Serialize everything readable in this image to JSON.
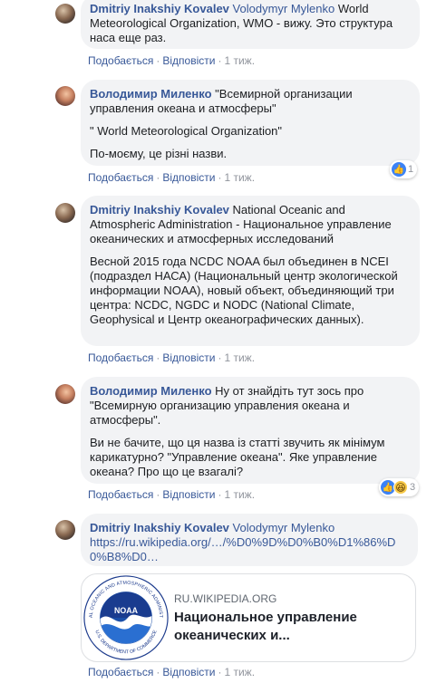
{
  "comments": [
    {
      "author": "Dmitriy Inakshiy Kovalev",
      "tag": "Volodymyr Mylenko",
      "text": [
        "World Meteorological Organization, WMO - вижу. Это структура наса еще раз."
      ],
      "like": "Подобається",
      "reply": "Відповісти",
      "time": "1 тиж."
    },
    {
      "author": "Володимир Миленко",
      "text": [
        "\"Всемирной организации управления океана и атмосферы\"",
        "\" World Meteorological Organization\"",
        "По-моєму, це різні назви."
      ],
      "like": "Подобається",
      "reply": "Відповісти",
      "time": "1 тиж.",
      "reactions": {
        "count": "1",
        "icons": [
          "like-icon"
        ]
      }
    },
    {
      "author": "Dmitriy Inakshiy Kovalev",
      "text": [
        "National Oceanic and Atmospheric Administration - Национальное управление океанических и атмосферных исследований",
        "Весной 2015 года NCDC NOAA был объединен в NCEI (подраздел НАСА) (Национальный центр экологической информации NOAA), новый объект, объединяющий три центра: NCDC, NGDC и NODC (National Climate, Geophysical и Центр океанографических данных)."
      ],
      "like": "Подобається",
      "reply": "Відповісти",
      "time": "1 тиж."
    },
    {
      "author": "Володимир Миленко",
      "text": [
        "Ну от знайдіть тут зось про \"Всемирную организацию управления океана и атмосферы\".",
        "Ви не бачите, що ця назва із статті звучить як мінімум карикатурно? \"Управление океана\". Яке управление океана? Про що це взагалі?"
      ],
      "like": "Подобається",
      "reply": "Відповісти",
      "time": "1 тиж.",
      "reactions": {
        "count": "3",
        "icons": [
          "like-icon",
          "haha-icon"
        ]
      }
    },
    {
      "author": "Dmitriy Inakshiy Kovalev",
      "tag": "Volodymyr Mylenko",
      "link": "https://ru.wikipedia.org/…/%D0%9D%D0%B0%D1%86%D0%B8%D0…",
      "like": "Подобається",
      "reply": "Відповісти",
      "time": "1 тиж.",
      "card": {
        "domain": "RU.WIKIPEDIA.ORG",
        "title": "Национальное управление океанических и...",
        "logo_text": "NOAA",
        "logo_ring_top": "NATIONAL OCEANIC AND ATMOSPHERIC ADMINISTRATION",
        "logo_ring_bottom": "U.S. DEPARTMENT OF COMMERCE"
      }
    }
  ],
  "colors": {
    "link": "#385898",
    "bubble": "#f2f3f5",
    "meta": "#90949c"
  }
}
